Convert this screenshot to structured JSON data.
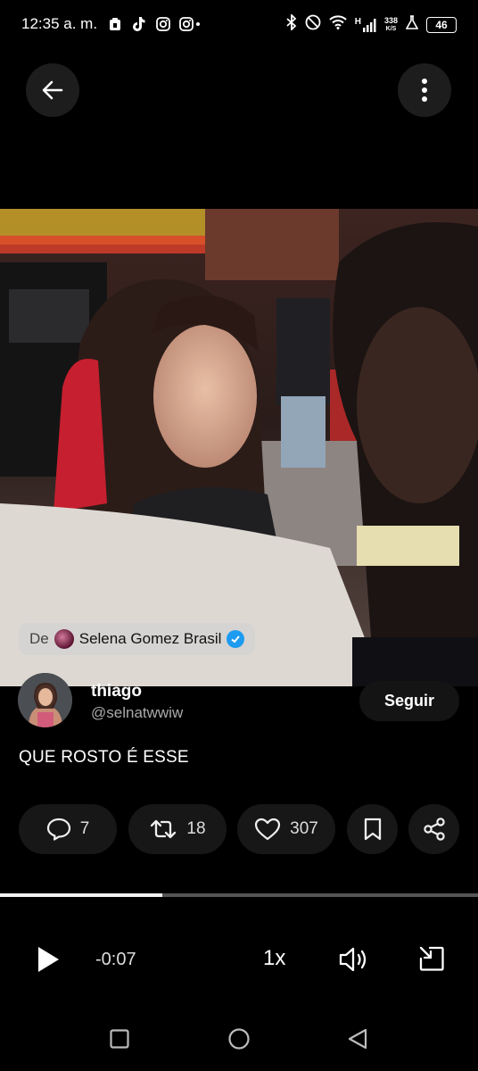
{
  "status_bar": {
    "time": "12:35 a. m.",
    "speed_value": "338",
    "speed_unit": "K/S",
    "network": "H",
    "battery": "46",
    "left_icons": [
      "clipboard-icon",
      "tiktok-icon",
      "instagram-icon",
      "instagram-icon"
    ],
    "right_icons": [
      "bluetooth-icon",
      "do-not-disturb-icon",
      "wifi-icon",
      "signal-icon",
      "lab-icon",
      "battery-icon"
    ]
  },
  "top_bar": {
    "back_icon": "arrow-left-icon",
    "more_icon": "more-vertical-icon"
  },
  "video": {
    "source_prefix": "De",
    "source_name": "Selena Gomez Brasil",
    "verified_color": "#1d9bf0"
  },
  "user": {
    "display_name": "thiago",
    "handle": "@selnatwwiw",
    "follow_label": "Seguir"
  },
  "tweet": {
    "text": "QUE ROSTO É ESSE"
  },
  "actions": {
    "replies": "7",
    "reposts": "18",
    "likes": "307"
  },
  "player": {
    "progress": 0.34,
    "remaining": "-0:07",
    "speed": "1x"
  },
  "nav": {
    "items": [
      "recents-icon",
      "home-icon",
      "back-icon"
    ]
  }
}
